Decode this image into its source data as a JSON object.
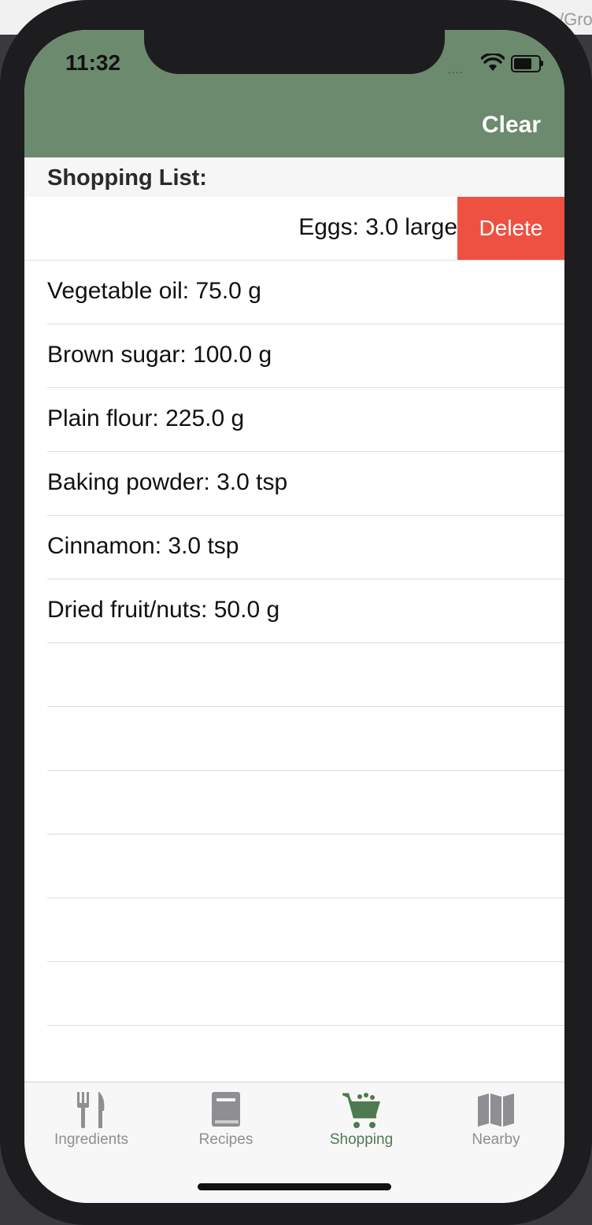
{
  "browser": {
    "url_fragment": "/Gro"
  },
  "status_bar": {
    "time": "11:32",
    "signal": "...."
  },
  "navbar": {
    "clear_label": "Clear",
    "color": "#6c8a6e"
  },
  "section": {
    "title": "Shopping List:"
  },
  "swiped_row": {
    "text": "Eggs: 3.0 large",
    "delete_label": "Delete",
    "delete_color": "#ee5142"
  },
  "items": [
    "Vegetable oil: 75.0 g",
    "Brown sugar: 100.0 g",
    "Plain flour: 225.0 g",
    "Baking powder: 3.0 tsp",
    "Cinnamon: 3.0 tsp",
    "Dried fruit/nuts: 50.0 g"
  ],
  "tabs": [
    {
      "label": "Ingredients",
      "icon": "fork-knife-icon",
      "active": false
    },
    {
      "label": "Recipes",
      "icon": "book-icon",
      "active": false
    },
    {
      "label": "Shopping",
      "icon": "cart-icon",
      "active": true
    },
    {
      "label": "Nearby",
      "icon": "map-icon",
      "active": false
    }
  ],
  "colors": {
    "tab_active": "#4f7a50",
    "tab_inactive": "#8e8e93"
  }
}
